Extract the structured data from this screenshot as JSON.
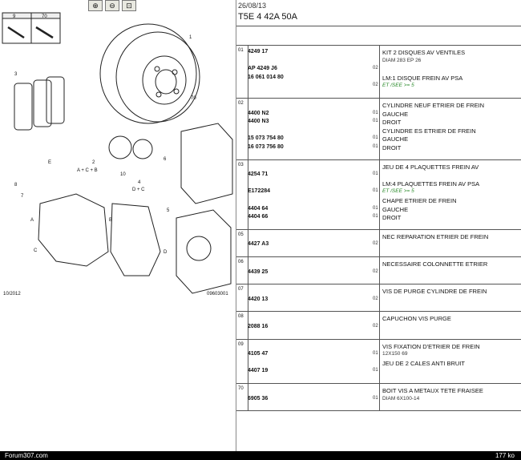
{
  "toolbar": {
    "btn1": "⊕",
    "btn2": "⊖",
    "btn3": "⊡"
  },
  "diagram": {
    "labels": [
      "9",
      "70",
      "1",
      "3",
      "70",
      "2",
      "A + C + B",
      "6",
      "10",
      "8",
      "E",
      "7",
      "4",
      "D + C",
      "5",
      "A",
      "C",
      "B",
      "D"
    ],
    "footer_left": "10/2012",
    "footer_right": "09603001"
  },
  "header": {
    "date": "26/08/13",
    "reference": "T5E 4 42A 50A"
  },
  "rows": [
    {
      "num": "01",
      "lines": [
        {
          "ref": "4249 17",
          "qty": "",
          "desc": "KIT 2 DISQUES AV VENTILES"
        },
        {
          "ref": "",
          "qty": "",
          "desc": "DIAM 283 EP 26",
          "cls": "small"
        },
        {
          "ref": "AP 4249 J6",
          "qty": "02",
          "desc": "",
          "cls": "small"
        },
        {
          "ref": "16 061 014 80",
          "qty": "",
          "desc": "LM:1 DISQUE FREIN AV PSA"
        },
        {
          "ref": "",
          "qty": "02",
          "desc": "ET /SEE >= 5",
          "cls": "green"
        }
      ]
    },
    {
      "num": "02",
      "lines": [
        {
          "ref": "",
          "qty": "",
          "desc": "CYLINDRE NEUF ETRIER DE FREIN"
        },
        {
          "ref": "4400 N2",
          "qty": "01",
          "desc": "GAUCHE"
        },
        {
          "ref": "4400 N3",
          "qty": "01",
          "desc": "DROIT"
        },
        {
          "ref": "",
          "qty": "",
          "desc": "CYLINDRE ES ETRIER DE FREIN"
        },
        {
          "ref": "15 073 754 80",
          "qty": "01",
          "desc": "GAUCHE"
        },
        {
          "ref": "16 073 756 80",
          "qty": "01",
          "desc": "DROIT"
        }
      ]
    },
    {
      "num": "03",
      "lines": [
        {
          "ref": "",
          "qty": "",
          "desc": "JEU DE 4 PLAQUETTES FREIN AV"
        },
        {
          "ref": "4254 71",
          "qty": "01",
          "desc": ""
        },
        {
          "ref": "",
          "qty": "",
          "desc": "LM:4 PLAQUETTES FREIN AV PSA"
        },
        {
          "ref": "E172284",
          "qty": "01",
          "desc": "ET /SEE >= 5",
          "cls": "green"
        },
        {
          "ref": "",
          "qty": "",
          "desc": "CHAPE ETRIER DE FREIN"
        },
        {
          "ref": "4404 64",
          "qty": "01",
          "desc": "GAUCHE"
        },
        {
          "ref": "4404 66",
          "qty": "01",
          "desc": "DROIT"
        }
      ]
    },
    {
      "num": "05",
      "lines": [
        {
          "ref": "",
          "qty": "",
          "desc": "NEC REPARATION ETRIER DE FREIN"
        },
        {
          "ref": "4427 A3",
          "qty": "02",
          "desc": ""
        }
      ]
    },
    {
      "num": "06",
      "lines": [
        {
          "ref": "",
          "qty": "",
          "desc": "NECESSAIRE COLONNETTE ETRIER"
        },
        {
          "ref": "4439 25",
          "qty": "02",
          "desc": ""
        }
      ]
    },
    {
      "num": "07",
      "lines": [
        {
          "ref": "",
          "qty": "",
          "desc": "VIS DE PURGE CYLINDRE DE FREIN"
        },
        {
          "ref": "4420 13",
          "qty": "02",
          "desc": ""
        }
      ]
    },
    {
      "num": "08",
      "lines": [
        {
          "ref": "",
          "qty": "",
          "desc": "CAPUCHON VIS PURGE"
        },
        {
          "ref": "2088 16",
          "qty": "02",
          "desc": ""
        }
      ]
    },
    {
      "num": "09",
      "lines": [
        {
          "ref": "",
          "qty": "",
          "desc": "VIS FIXATION D'ETRIER DE FREIN"
        },
        {
          "ref": "4105 47",
          "qty": "01",
          "desc": "12X150 69",
          "cls": "small"
        },
        {
          "ref": "",
          "qty": "",
          "desc": "JEU DE 2 CALES ANTI BRUIT"
        },
        {
          "ref": "4407 19",
          "qty": "01",
          "desc": ""
        }
      ]
    },
    {
      "num": "70",
      "lines": [
        {
          "ref": "",
          "qty": "",
          "desc": "BOIT VIS A METAUX TETE FRAISEE"
        },
        {
          "ref": "6905 36",
          "qty": "01",
          "desc": "DIAM 6X100-14",
          "cls": "small"
        }
      ]
    }
  ],
  "footer": {
    "site": "Forum307.com",
    "size": "177 ko"
  }
}
